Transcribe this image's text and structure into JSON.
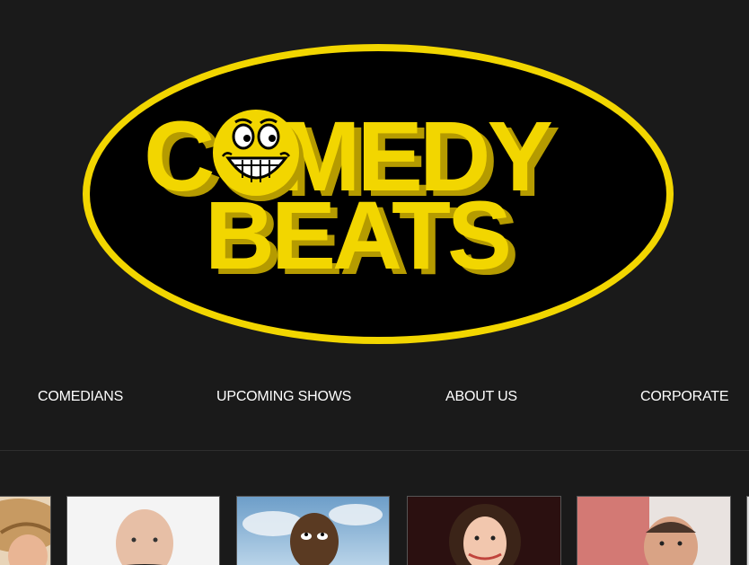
{
  "brand": {
    "logo_alt": "COMEDY BEATS",
    "colors": {
      "background": "#1a1a1a",
      "logo_yellow": "#f2d600",
      "logo_shadow": "#c9ac00",
      "nav_text": "#ffffff"
    }
  },
  "nav": {
    "items": [
      {
        "label": "COMEDIANS"
      },
      {
        "label": "UPCOMING SHOWS"
      },
      {
        "label": "ABOUT US"
      },
      {
        "label": "CORPORATE"
      }
    ]
  },
  "carousel": {
    "items": [
      {
        "icon": "comedian-photo-hat"
      },
      {
        "icon": "comedian-photo-bald-man"
      },
      {
        "icon": "comedian-photo-man-sky"
      },
      {
        "icon": "comedian-photo-woman"
      },
      {
        "icon": "comedian-photo-man-red"
      },
      {
        "icon": "comedian-photo-partial"
      }
    ]
  }
}
